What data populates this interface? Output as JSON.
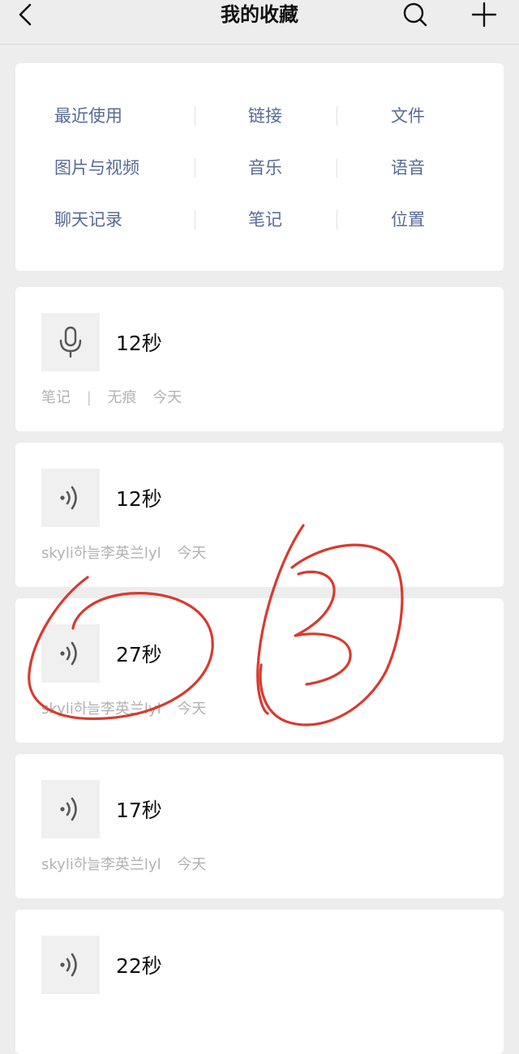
{
  "header": {
    "title": "我的收藏",
    "back_icon": "chevron-left-icon",
    "search_icon": "search-icon",
    "add_icon": "plus-icon"
  },
  "categories": [
    [
      "最近使用",
      "链接",
      "文件"
    ],
    [
      "图片与视频",
      "音乐",
      "语音"
    ],
    [
      "聊天记录",
      "笔记",
      "位置"
    ]
  ],
  "items": [
    {
      "icon": "microphone-icon",
      "duration": "12秒",
      "source": "笔记",
      "separator": "|",
      "sub": "无痕",
      "time": "今天"
    },
    {
      "icon": "voice-waves-icon",
      "duration": "12秒",
      "source": "skyli하늘李英兰lyl",
      "time": "今天"
    },
    {
      "icon": "voice-waves-icon",
      "duration": "27秒",
      "source": "skyli하늘李英兰lyl",
      "time": "今天"
    },
    {
      "icon": "voice-waves-icon",
      "duration": "17秒",
      "source": "skyli하늘李英兰lyl",
      "time": "今天"
    },
    {
      "icon": "voice-waves-icon",
      "duration": "22秒"
    }
  ],
  "colors": {
    "link": "#576b95",
    "annotation": "#d93a2f",
    "background": "#ededed"
  }
}
